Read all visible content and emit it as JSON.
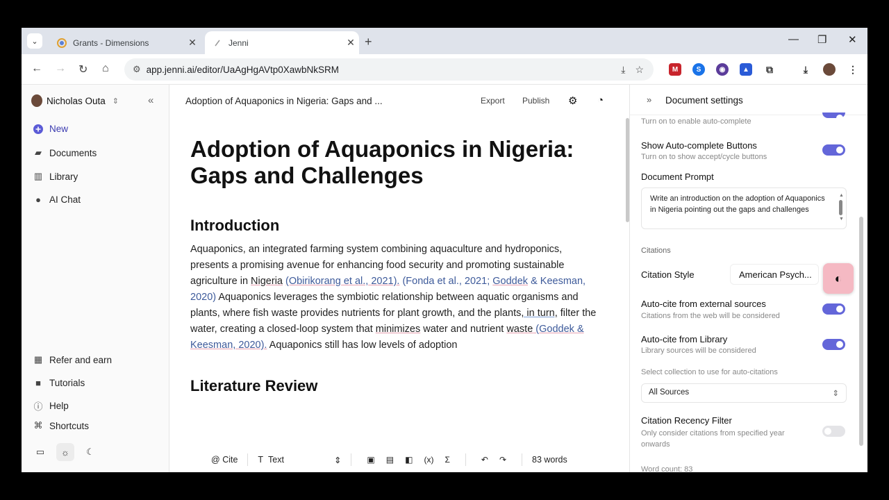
{
  "browser": {
    "tabs": [
      {
        "label": "Grants - Dimensions"
      },
      {
        "label": "Jenni"
      }
    ],
    "url": "app.jenni.ai/editor/UaAgHgAVtp0XawbNkSRM"
  },
  "sidebar": {
    "user_name": "Nicholas Outa",
    "items": [
      {
        "label": "New"
      },
      {
        "label": "Documents"
      },
      {
        "label": "Library"
      },
      {
        "label": "AI Chat"
      }
    ],
    "bottom_items": [
      {
        "label": "Refer and earn"
      },
      {
        "label": "Tutorials"
      },
      {
        "label": "Help"
      },
      {
        "label": "Shortcuts"
      }
    ]
  },
  "editor": {
    "doc_title_short": "Adoption of Aquaponics in Nigeria: Gaps and ...",
    "export_label": "Export",
    "publish_label": "Publish",
    "title": "Adoption of Aquaponics in Nigeria: Gaps and Challenges",
    "h_intro": "Introduction",
    "p1": "Aquaponics, an integrated farming system combining aquaculture and hydroponics, presents a promising avenue for enhancing food security and promoting sustainable agriculture in ",
    "w_nigeria": "Nigeria",
    "c1": "(Obirikorang et al., 2021).",
    "c2a": "(Fonda et al., 2021; ",
    "c2b": "Goddek",
    "c2c": " & Keesman, 2020)",
    "p2": " Aquaponics leverages the symbiotic relationship between aquatic organisms and plants, where fish waste provides nutrients for plant growth, and the plants",
    "w_inturn": ", in turn,",
    "p3": " filter the water, creating a closed-loop system that ",
    "w_minimizes": "minimizes",
    "p4": " water and nutrient ",
    "w_waste": "waste",
    "c3a": " (",
    "c3b": "Goddek",
    "c3c": " & Keesman, 2020).",
    "p5": " Aquaponics still has low levels of adoption",
    "h_lit": "Literature Review",
    "bottom": {
      "cite_label": "Cite",
      "text_style": "Text",
      "word_count": "83 words"
    }
  },
  "panel": {
    "title": "Document settings",
    "autocomplete_sub": "Turn on to enable auto-complete",
    "show_buttons_label": "Show Auto-complete Buttons",
    "show_buttons_sub": "Turn on to show accept/cycle buttons",
    "prompt_label": "Document Prompt",
    "prompt_text": "Write an introduction on the adoption of Aquaponics in Nigeria pointing out the gaps and challenges",
    "citations_heading": "Citations",
    "citation_style_label": "Citation Style",
    "citation_style_value": "American Psych...",
    "autocite_ext_label": "Auto-cite from external sources",
    "autocite_ext_sub": "Citations from the web will be considered",
    "autocite_lib_label": "Auto-cite from Library",
    "autocite_lib_sub": "Library sources will be considered",
    "collection_label": "Select collection to use for auto-citations",
    "collection_value": "All Sources",
    "recency_label": "Citation Recency Filter",
    "recency_sub": "Only consider citations from specified year onwards",
    "word_count_label": "Word count: 83"
  },
  "colors": {
    "accent": "#6366d9",
    "citation": "#3d5a9a",
    "underline_spell": "#e8a0b0"
  }
}
